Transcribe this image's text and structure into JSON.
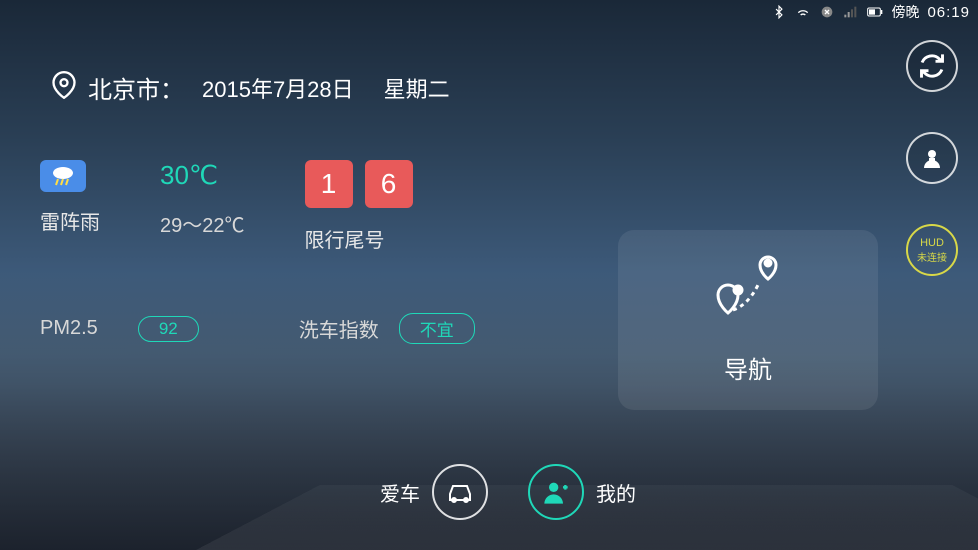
{
  "status_bar": {
    "period": "傍晚",
    "time": "06:19"
  },
  "header": {
    "location": "北京市：",
    "date": "2015年7月28日",
    "weekday": "星期二"
  },
  "weather": {
    "condition": "雷阵雨",
    "temp_current": "30℃",
    "temp_range": "29～22℃",
    "restrict_digit1": "1",
    "restrict_digit2": "6",
    "restrict_label": "限行尾号",
    "pm_label": "PM2.5",
    "pm_value": "92",
    "wash_label": "洗车指数",
    "wash_value": "不宜"
  },
  "right": {
    "hud_label": "HUD",
    "hud_status": "未连接"
  },
  "nav": {
    "label": "导航"
  },
  "bottom": {
    "car_label": "爱车",
    "mine_label": "我的"
  }
}
